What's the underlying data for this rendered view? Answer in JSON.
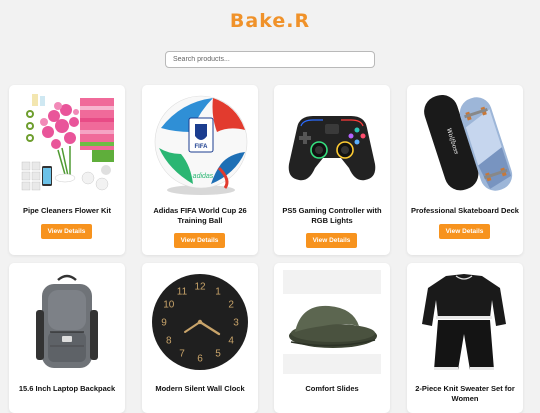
{
  "header": {
    "title": "Bake.R"
  },
  "search": {
    "placeholder": "Search products..."
  },
  "products": [
    {
      "title": "Pipe Cleaners Flower Kit",
      "button": "View Details"
    },
    {
      "title": "Adidas FIFA World Cup 26 Training Ball",
      "button": "View Details"
    },
    {
      "title": "PS5 Gaming Controller with RGB Lights",
      "button": "View Details"
    },
    {
      "title": "Professional Skateboard Deck",
      "button": "View Details"
    },
    {
      "title": "15.6 Inch Laptop Backpack"
    },
    {
      "title": "Modern Silent Wall Clock"
    },
    {
      "title": "Comfort Slides"
    },
    {
      "title": "2-Piece Knit Sweater Set for Women"
    }
  ],
  "ball_text": "FIFA",
  "skateboard_text": "Wolfboss",
  "clock_numbers": [
    "12",
    "1",
    "2",
    "3",
    "4",
    "5",
    "6",
    "7",
    "8",
    "9",
    "10",
    "11"
  ],
  "colors": {
    "accent": "#f7931e",
    "logo": "#f0922a",
    "background": "#f2f2f2"
  }
}
